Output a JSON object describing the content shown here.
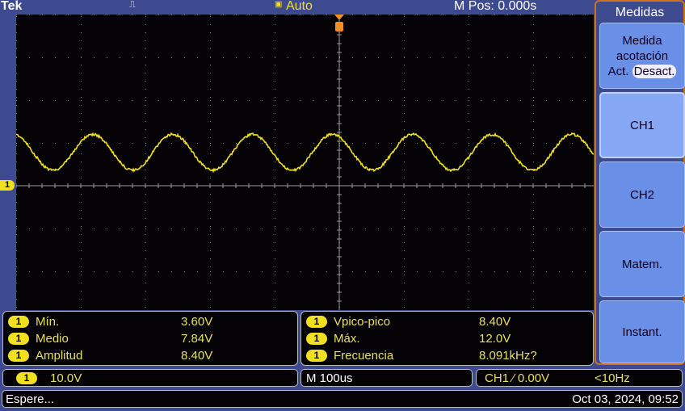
{
  "header": {
    "brand": "Tek",
    "acq_icon": "pulse-icon",
    "trigger_mode_icon": "trigger-b-icon",
    "trigger_mode": "Auto",
    "position": "M Pos: 0.000s"
  },
  "waveform": {
    "channel": "1",
    "color": "#f0e020",
    "min_v": 3.6,
    "max_v": 12.0,
    "frequency_hz": 8091,
    "volts_per_div": 10.0,
    "time_per_div_us": 100
  },
  "measurements": {
    "left": [
      {
        "ch": "1",
        "label": "Mín.",
        "value": "3.60V"
      },
      {
        "ch": "1",
        "label": "Medio",
        "value": "7.84V"
      },
      {
        "ch": "1",
        "label": "Amplitud",
        "value": "8.40V"
      }
    ],
    "right": [
      {
        "ch": "1",
        "label": "Vpico-pico",
        "value": "8.40V"
      },
      {
        "ch": "1",
        "label": "Máx.",
        "value": "12.0V"
      },
      {
        "ch": "1",
        "label": "Frecuencia",
        "value": "8.091kHz?"
      }
    ]
  },
  "status": {
    "ch": "1",
    "scale": "10.0V",
    "timebase": "M 100us",
    "trigger": "CH1 ⁄ 0.00V",
    "trig_freq": "<10Hz",
    "message": "Espere...",
    "datetime": "Oct 03, 2024, 09:52"
  },
  "menu": {
    "title": "Medidas",
    "gating_l1": "Medida",
    "gating_l2": "acotación",
    "gating_on": "Act.",
    "gating_off": "Desact.",
    "ch1": "CH1",
    "ch2": "CH2",
    "math": "Matem.",
    "snapshot": "Instant."
  }
}
